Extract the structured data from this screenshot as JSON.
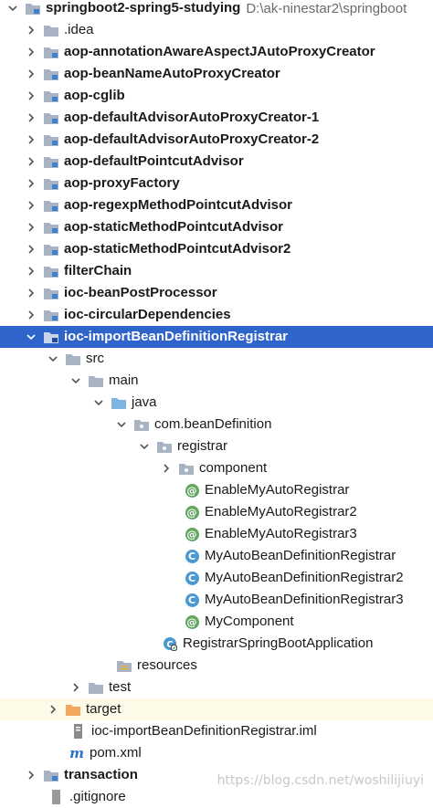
{
  "project": {
    "name": "springboot2-spring5-studying",
    "path": "D:\\ak-ninestar2\\springboot"
  },
  "modules": [
    ".idea",
    "aop-annotationAwareAspectJAutoProxyCreator",
    "aop-beanNameAutoProxyCreator",
    "aop-cglib",
    "aop-defaultAdvisorAutoProxyCreator-1",
    "aop-defaultAdvisorAutoProxyCreator-2",
    "aop-defaultPointcutAdvisor",
    "aop-proxyFactory",
    "aop-regexpMethodPointcutAdvisor",
    "aop-staticMethodPointcutAdvisor",
    "aop-staticMethodPointcutAdvisor2",
    "filterChain",
    "ioc-beanPostProcessor",
    "ioc-circularDependencies"
  ],
  "selected_module": "ioc-importBeanDefinitionRegistrar",
  "tree": {
    "src": "src",
    "main": "main",
    "java": "java",
    "package": "com.beanDefinition",
    "registrar": "registrar",
    "component": "component",
    "files": [
      {
        "name": "EnableMyAutoRegistrar",
        "kind": "@"
      },
      {
        "name": "EnableMyAutoRegistrar2",
        "kind": "@"
      },
      {
        "name": "EnableMyAutoRegistrar3",
        "kind": "@"
      },
      {
        "name": "MyAutoBeanDefinitionRegistrar",
        "kind": "C"
      },
      {
        "name": "MyAutoBeanDefinitionRegistrar2",
        "kind": "C"
      },
      {
        "name": "MyAutoBeanDefinitionRegistrar3",
        "kind": "C"
      },
      {
        "name": "MyComponent",
        "kind": "@"
      }
    ],
    "app_class": "RegistrarSpringBootApplication",
    "resources": "resources",
    "test": "test",
    "target": "target",
    "iml": "ioc-importBeanDefinitionRegistrar.iml",
    "pom": "pom.xml",
    "pom_icon": "m"
  },
  "after": [
    "transaction",
    ".gitignore"
  ],
  "watermark": "https://blog.csdn.net/woshilijiuyi",
  "colors": {
    "selection": "#2f65ca",
    "folder": "#a8b4c4",
    "source_folder": "#7fb3e0",
    "target_folder": "#f0a860",
    "annotation": "#5fa65f",
    "class": "#4a9ad1"
  }
}
